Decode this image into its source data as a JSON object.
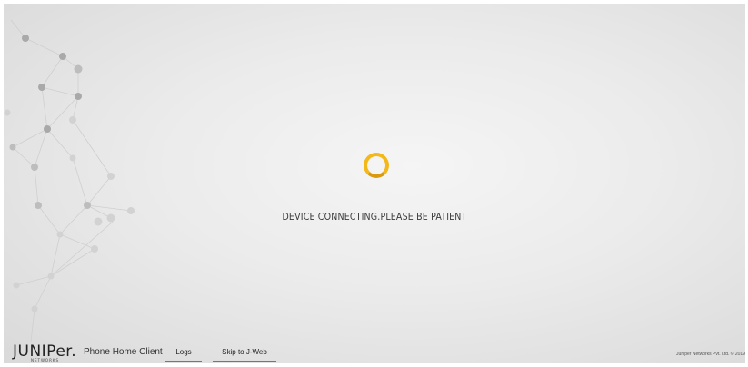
{
  "status": {
    "message": "DEVICE CONNECTING.PLEASE BE PATIENT",
    "spinner_color": "#f3b91a"
  },
  "footer": {
    "logo_text": "JUNIPer.",
    "logo_subtext": "NETWORKS",
    "app_name": "Phone Home Client",
    "links": [
      {
        "label": "Logs"
      },
      {
        "label": "Skip to J-Web"
      }
    ],
    "link_underline_color": "#e0465b",
    "copyright": "Juniper Networks Pvt. Ltd. © 2019"
  }
}
